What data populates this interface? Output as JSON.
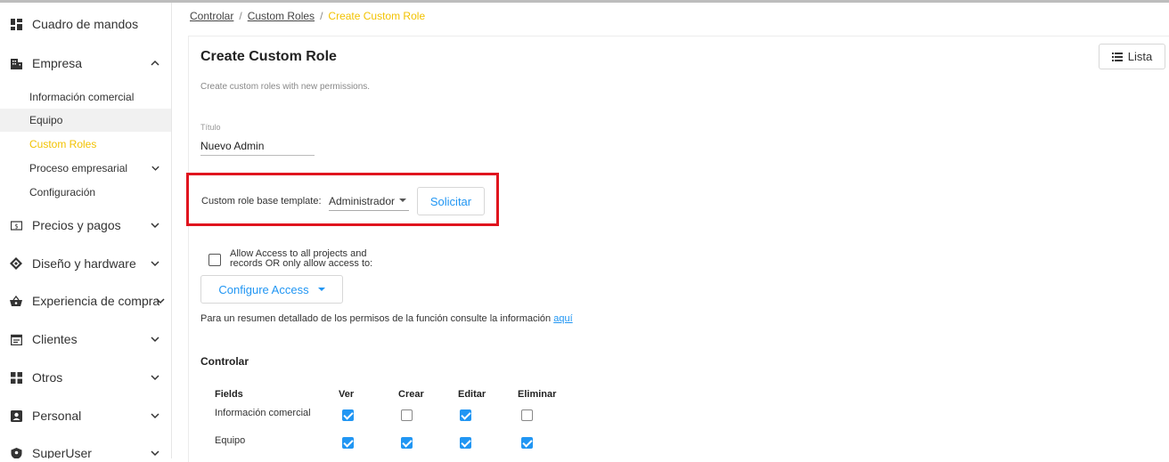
{
  "sidebar": {
    "items": [
      {
        "label": "Cuadro de mandos",
        "icon": "dashboard-icon"
      },
      {
        "label": "Empresa",
        "icon": "building-icon",
        "expanded": true
      },
      {
        "label": "Precios y pagos",
        "icon": "price-tag-icon"
      },
      {
        "label": "Diseño y hardware",
        "icon": "design-icon"
      },
      {
        "label": "Experiencia de compra",
        "icon": "basket-icon"
      },
      {
        "label": "Clientes",
        "icon": "clients-icon"
      },
      {
        "label": "Otros",
        "icon": "others-icon"
      },
      {
        "label": "Personal",
        "icon": "personal-icon"
      },
      {
        "label": "SuperUser",
        "icon": "superuser-icon"
      }
    ],
    "empresa_sub": [
      {
        "label": "Información comercial"
      },
      {
        "label": "Equipo"
      },
      {
        "label": "Custom Roles"
      },
      {
        "label": "Proceso empresarial"
      },
      {
        "label": "Configuración"
      }
    ]
  },
  "breadcrumb": {
    "items": [
      "Controlar",
      "Custom Roles"
    ],
    "current": "Create Custom Role",
    "separator": "/"
  },
  "header": {
    "title": "Create Custom Role",
    "subtitle": "Create custom roles with new permissions.",
    "list_button": "Lista",
    "list_icon": "list-icon"
  },
  "form": {
    "title_label": "Título",
    "title_value": "Nuevo Admin",
    "template_label": "Custom role base template:",
    "template_value": "Administrador",
    "apply_button": "Solicitar",
    "allow_access_text": "Allow Access to all projects and records OR only allow access to:",
    "allow_access_checked": false,
    "configure_access": "Configure Access",
    "info_text": "Para un resumen detallado de los permisos de la función consulte la información",
    "info_link": "aquí"
  },
  "permissions": {
    "section": "Controlar",
    "columns": [
      "Fields",
      "Ver",
      "Crear",
      "Editar",
      "Eliminar"
    ],
    "rows": [
      {
        "label": "Información comercial",
        "values": [
          true,
          false,
          true,
          false
        ]
      },
      {
        "label": "Equipo",
        "values": [
          true,
          true,
          true,
          true
        ]
      }
    ]
  },
  "colors": {
    "accent_blue": "#2196f3",
    "active_yellow": "#f2c200",
    "highlight_red": "#e0141e"
  }
}
